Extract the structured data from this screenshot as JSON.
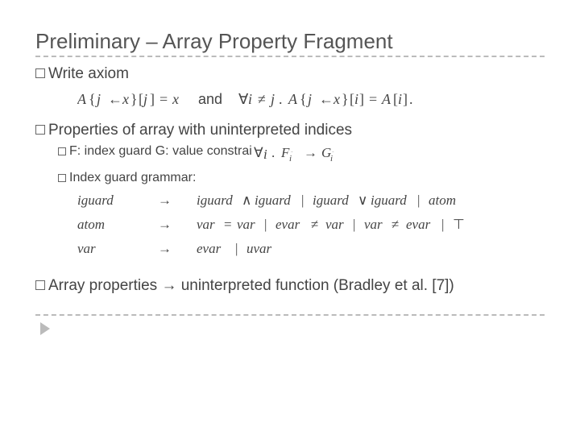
{
  "title": "Preliminary – Array Property Fragment",
  "write": {
    "label": "Write axiom"
  },
  "properties": {
    "label": "Properties of array with uninterpreted indices",
    "f_item": "F: index guard   G: value constrai",
    "ig_item": "Index guard grammar:"
  },
  "array": {
    "prefix": "Array properties ",
    "suffix": " uninterpreted function (Bradley et al. [7])"
  }
}
